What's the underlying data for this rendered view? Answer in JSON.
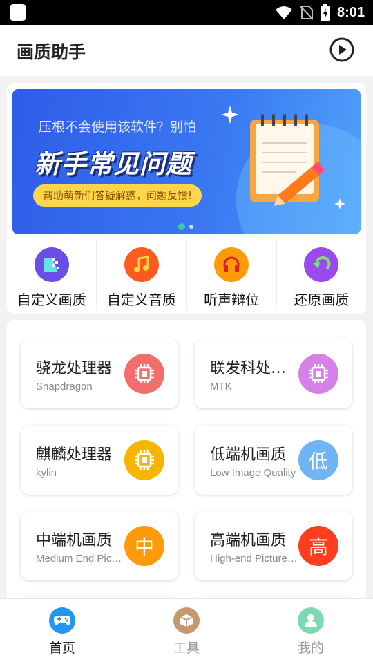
{
  "status_bar": {
    "time": "8:01"
  },
  "app_bar": {
    "title": "画质助手"
  },
  "banner": {
    "subtitle": "压根不会使用该软件？别怕",
    "headline": "新手常见问题",
    "pill": "帮助萌新们答疑解惑，问题反馈!"
  },
  "quick_actions": [
    {
      "label": "自定义画质",
      "icon": "grid-icon",
      "color": "#6b4ee6"
    },
    {
      "label": "自定义音质",
      "icon": "music-note-icon",
      "color": "#ff5a1f"
    },
    {
      "label": "听声辩位",
      "icon": "headphones-icon",
      "color": "#ff9a0a"
    },
    {
      "label": "还原画质",
      "icon": "restore-icon",
      "color": "#9b4af0"
    }
  ],
  "chips": [
    {
      "title": "骁龙处理器",
      "subtitle": "Snapdragon",
      "glyph": "",
      "color": "#f36d6d"
    },
    {
      "title": "联发科处理器",
      "subtitle": "MTK",
      "glyph": "",
      "color": "#d680e8"
    },
    {
      "title": "麒麟处理器",
      "subtitle": "kylin",
      "glyph": "",
      "color": "#f7b500"
    },
    {
      "title": "低端机画质",
      "subtitle": "Low Image Quality",
      "glyph": "低",
      "color": "#6fb4f3"
    },
    {
      "title": "中端机画质",
      "subtitle": "Medium End Picture Quality",
      "glyph": "中",
      "color": "#ff9a0a"
    },
    {
      "title": "高端机画质",
      "subtitle": "High-end Picture Quality",
      "glyph": "高",
      "color": "#ff3d1f"
    }
  ],
  "tabs": [
    {
      "label": "首页",
      "icon": "gamepad-icon",
      "color": "#2196f3",
      "active": true
    },
    {
      "label": "工具",
      "icon": "box-icon",
      "color": "#c49a6c",
      "active": false
    },
    {
      "label": "我的",
      "icon": "person-icon",
      "color": "#7ed9b0",
      "active": false
    }
  ]
}
